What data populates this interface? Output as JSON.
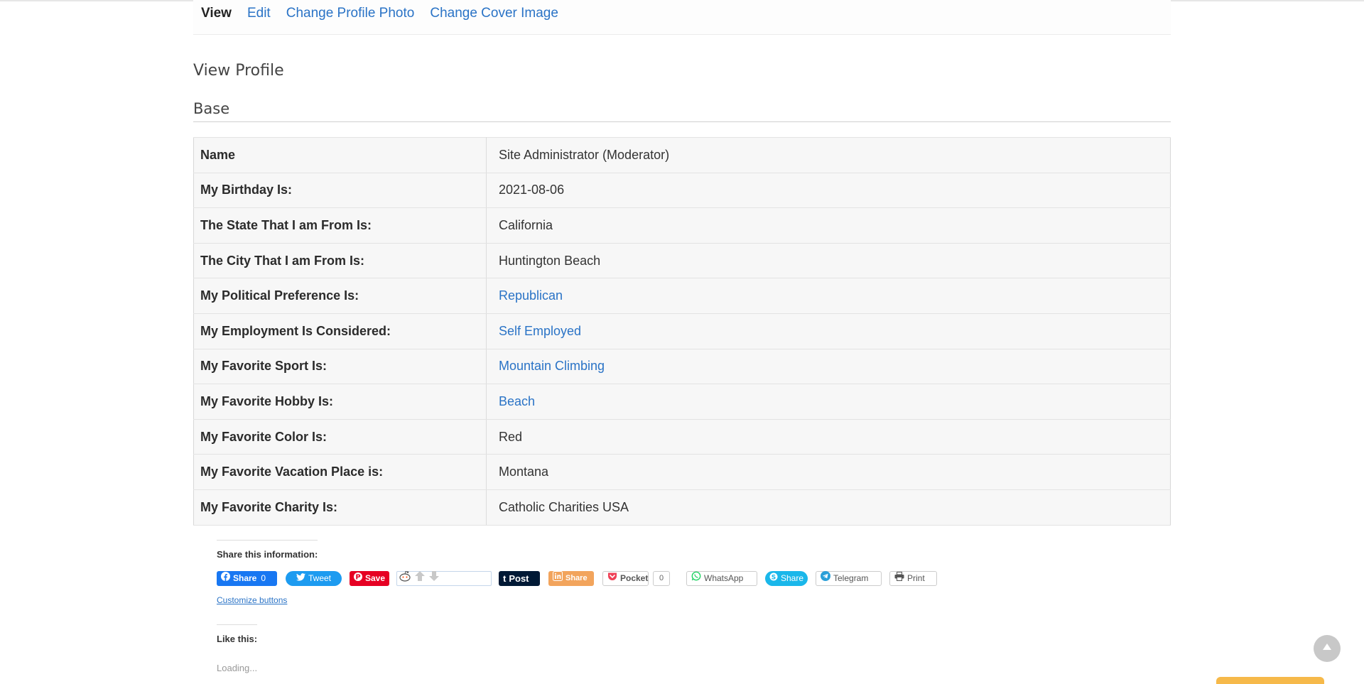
{
  "tabs": [
    {
      "label": "View",
      "active": true
    },
    {
      "label": "Edit"
    },
    {
      "label": "Change Profile Photo"
    },
    {
      "label": "Change Cover Image"
    }
  ],
  "page_title": "View Profile",
  "section_title": "Base",
  "fields": [
    {
      "label": "Name",
      "value": "Site Administrator (Moderator)",
      "link": false
    },
    {
      "label": "My Birthday Is:",
      "value": "2021-08-06",
      "link": false
    },
    {
      "label": "The State That I am From Is:",
      "value": "California",
      "link": false
    },
    {
      "label": "The City That I am From Is:",
      "value": "Huntington Beach",
      "link": false
    },
    {
      "label": "My Political Preference Is:",
      "value": "Republican",
      "link": true
    },
    {
      "label": "My Employment Is Considered:",
      "value": "Self Employed",
      "link": true
    },
    {
      "label": "My Favorite Sport Is:",
      "value": "Mountain Climbing",
      "link": true
    },
    {
      "label": "My Favorite Hobby Is:",
      "value": "Beach",
      "link": true
    },
    {
      "label": "My Favorite Color Is:",
      "value": "Red",
      "link": false
    },
    {
      "label": "My Favorite Vacation Place is:",
      "value": "Montana",
      "link": false
    },
    {
      "label": "My Favorite Charity Is:",
      "value": "Catholic Charities USA",
      "link": false
    }
  ],
  "share": {
    "heading": "Share this information:",
    "facebook": {
      "label": "Share",
      "count": "0"
    },
    "twitter": "Tweet",
    "pinterest": "Save",
    "tumblr": "Post",
    "linkedin": "Share",
    "pocket": {
      "label": "Pocket",
      "count": "0"
    },
    "whatsapp": "WhatsApp",
    "skype": "Share",
    "telegram": "Telegram",
    "print": "Print",
    "customize": "Customize buttons"
  },
  "like": {
    "heading": "Like this:",
    "loading": "Loading..."
  },
  "colors": {
    "link": "#2a73c6",
    "facebook": "#1877f2",
    "twitter": "#1d9bf0",
    "pinterest": "#e60023",
    "tumblr": "#001935",
    "linkedin": "#f2a45c",
    "skype": "#1ab7ea"
  },
  "icons": [
    "facebook-icon",
    "twitter-icon",
    "pinterest-icon",
    "reddit-icon",
    "upvote-icon",
    "downvote-icon",
    "tumblr-icon",
    "linkedin-icon",
    "pocket-icon",
    "whatsapp-icon",
    "skype-icon",
    "telegram-icon",
    "print-icon",
    "arrow-up-icon"
  ]
}
